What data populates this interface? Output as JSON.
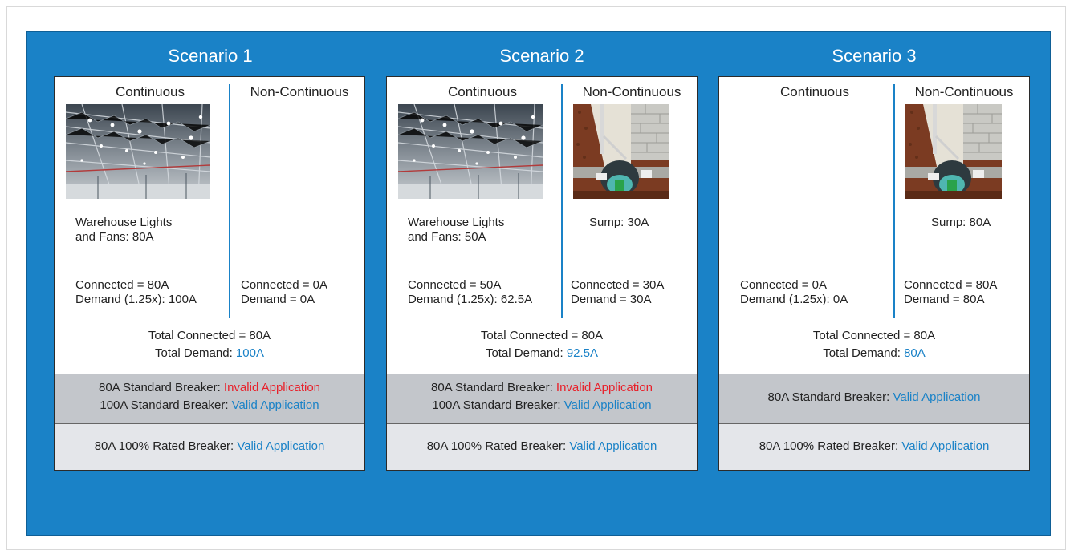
{
  "scenarios": [
    {
      "title": "Scenario 1",
      "continuous_head": "Continuous",
      "noncontinuous_head": "Non-Continuous",
      "cont_load_line1": "Warehouse Lights",
      "cont_load_line2": "and Fans:   80A",
      "noncont_load": "",
      "cont_connected": "Connected = 80A",
      "cont_demand": "Demand (1.25x): 100A",
      "noncont_connected": "Connected = 0A",
      "noncont_demand": "Demand = 0A",
      "total_connected": "Total Connected = 80A",
      "total_demand_label": "Total Demand: ",
      "total_demand_value": "100A",
      "std1_label": "80A Standard Breaker:  ",
      "std1_status": "Invalid Application",
      "std2_label": "100A Standard Breaker: ",
      "std2_status": "Valid Application",
      "rated_label": "80A 100% Rated Breaker:  ",
      "rated_status": "Valid Application"
    },
    {
      "title": "Scenario 2",
      "continuous_head": "Continuous",
      "noncontinuous_head": "Non-Continuous",
      "cont_load_line1": "Warehouse Lights",
      "cont_load_line2": "and Fans:   50A",
      "noncont_load": "Sump: 30A",
      "cont_connected": "Connected = 50A",
      "cont_demand": "Demand (1.25x): 62.5A",
      "noncont_connected": "Connected = 30A",
      "noncont_demand": "Demand = 30A",
      "total_connected": "Total Connected = 80A",
      "total_demand_label": "Total Demand: ",
      "total_demand_value": "92.5A",
      "std1_label": "80A Standard Breaker:  ",
      "std1_status": "Invalid Application",
      "std2_label": "100A Standard Breaker: ",
      "std2_status": "Valid Application",
      "rated_label": "80A 100% Rated Breaker:  ",
      "rated_status": "Valid Application"
    },
    {
      "title": "Scenario 3",
      "continuous_head": "Continuous",
      "noncontinuous_head": "Non-Continuous",
      "cont_load_line1": "",
      "cont_load_line2": "",
      "noncont_load": "Sump: 80A",
      "cont_connected": "Connected = 0A",
      "cont_demand": "Demand (1.25x): 0A",
      "noncont_connected": "Connected = 80A",
      "noncont_demand": "Demand = 80A",
      "total_connected": "Total Connected = 80A",
      "total_demand_label": "Total Demand: ",
      "total_demand_value": "80A",
      "std1_label": "80A Standard Breaker:  ",
      "std1_status": "Valid Application",
      "rated_label": "80A 100% Rated Breaker:  ",
      "rated_status": "Valid Application"
    }
  ],
  "colors": {
    "background_blue": "#1a82c7",
    "valid": "#1a82c7",
    "invalid": "#e8202a",
    "band_dark": "#c3c6cb",
    "band_light": "#e4e6ea"
  },
  "icons": {
    "warehouse_photo": "warehouse-lights-photo",
    "sump_photo": "sump-pump-illustration"
  }
}
